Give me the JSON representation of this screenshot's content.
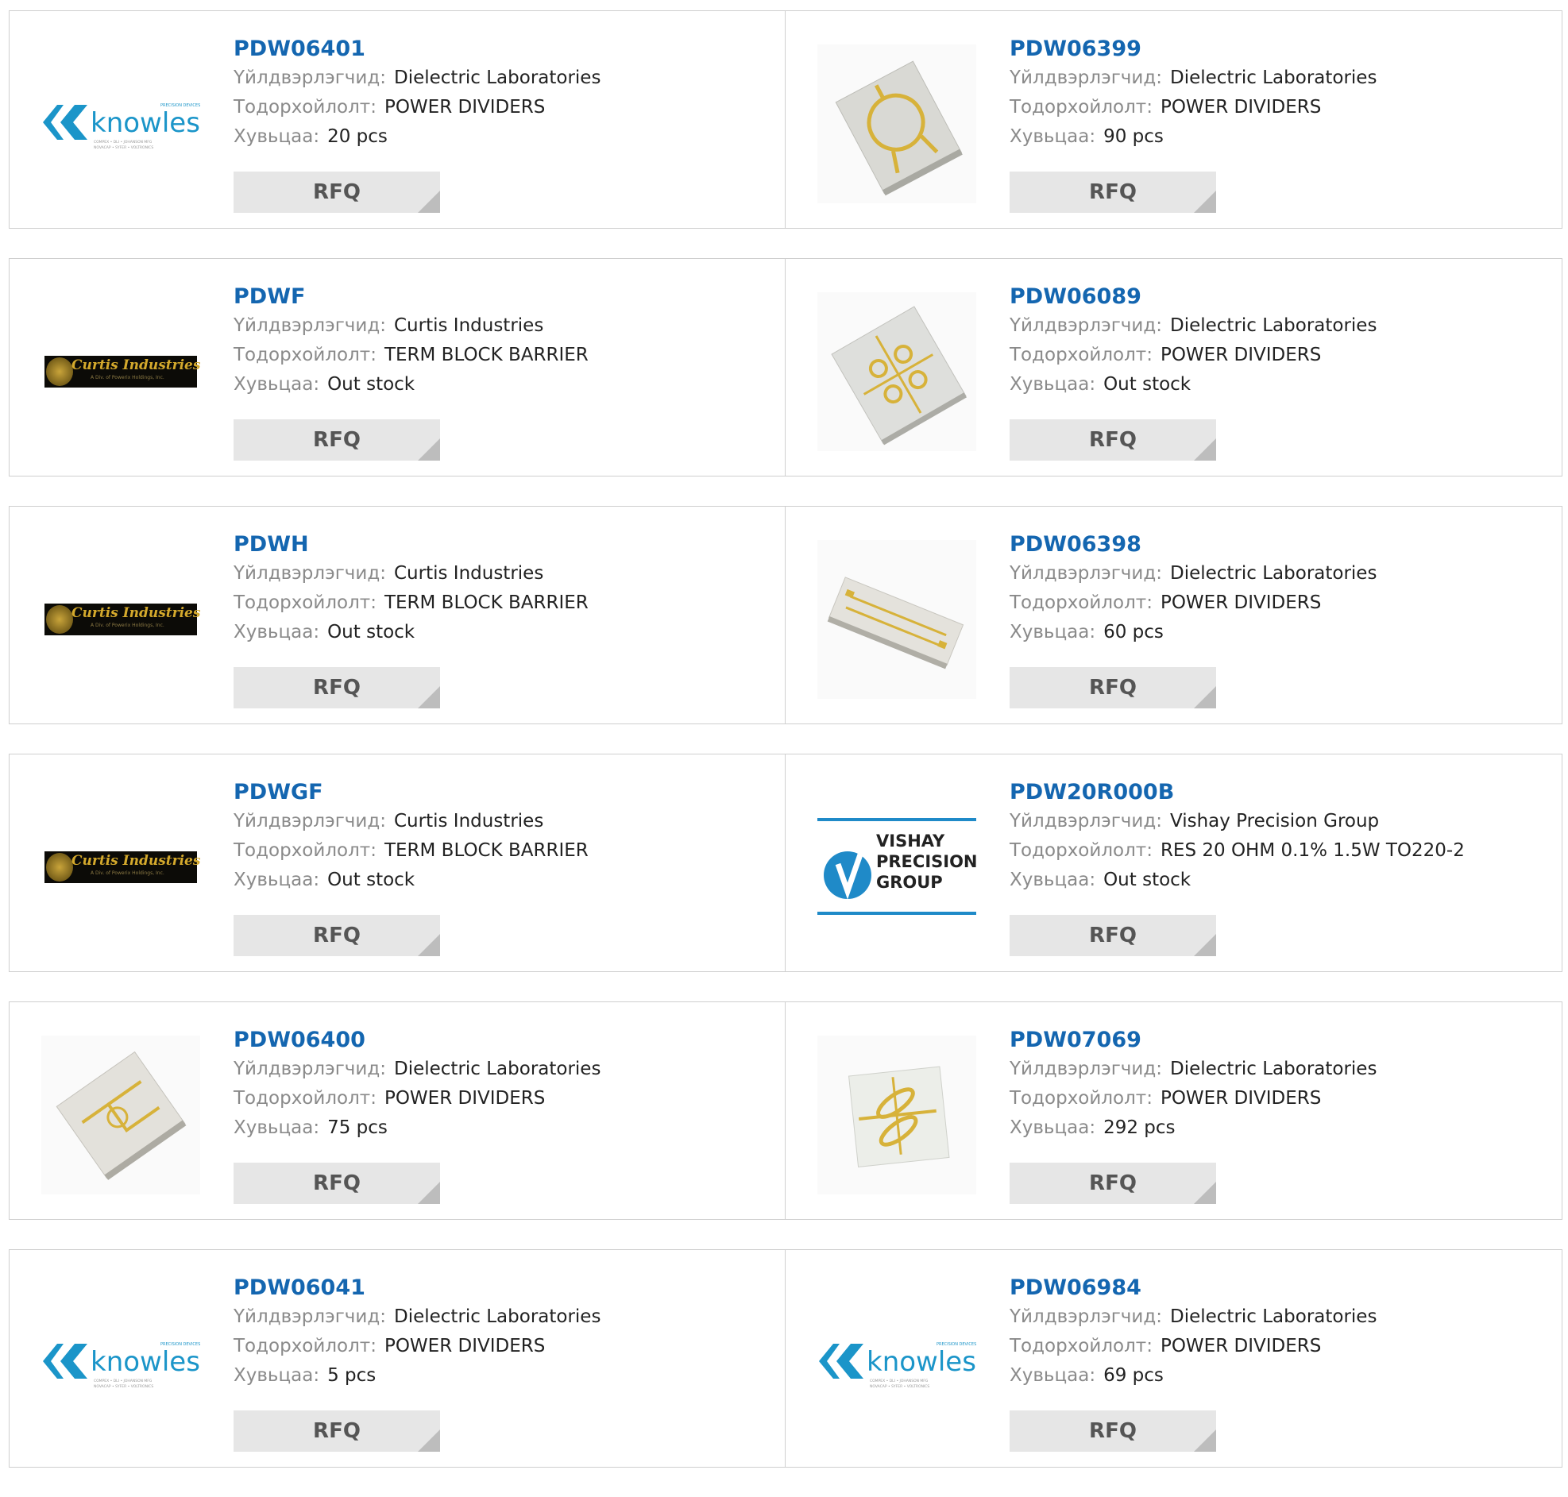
{
  "labels": {
    "manufacturer": "Үйлдвэрлэгчид:",
    "description": "Тодорхойлолт:",
    "stock": "Хувьцаа:",
    "rfq": "RFQ"
  },
  "products": [
    {
      "part": "PDW06401",
      "manufacturer": "Dielectric Laboratories",
      "description": "POWER DIVIDERS",
      "stock": "20 pcs",
      "image": "knowles-logo"
    },
    {
      "part": "PDW06399",
      "manufacturer": "Dielectric Laboratories",
      "description": "POWER DIVIDERS",
      "stock": "90 pcs",
      "image": "chip-circle"
    },
    {
      "part": "PDWF",
      "manufacturer": "Curtis Industries",
      "description": "TERM BLOCK BARRIER",
      "stock": "Out stock",
      "image": "curtis-logo"
    },
    {
      "part": "PDW06089",
      "manufacturer": "Dielectric Laboratories",
      "description": "POWER DIVIDERS",
      "stock": "Out stock",
      "image": "chip-pattern"
    },
    {
      "part": "PDWH",
      "manufacturer": "Curtis Industries",
      "description": "TERM BLOCK BARRIER",
      "stock": "Out stock",
      "image": "curtis-logo"
    },
    {
      "part": "PDW06398",
      "manufacturer": "Dielectric Laboratories",
      "description": "POWER DIVIDERS",
      "stock": "60 pcs",
      "image": "chip-long"
    },
    {
      "part": "PDWGF",
      "manufacturer": "Curtis Industries",
      "description": "TERM BLOCK BARRIER",
      "stock": "Out stock",
      "image": "curtis-logo"
    },
    {
      "part": "PDW20R000B",
      "manufacturer": "Vishay Precision Group",
      "description": "RES 20 OHM 0.1% 1.5W TO220-2",
      "stock": "Out stock",
      "image": "vishay-logo"
    },
    {
      "part": "PDW06400",
      "manufacturer": "Dielectric Laboratories",
      "description": "POWER DIVIDERS",
      "stock": "75 pcs",
      "image": "chip-square"
    },
    {
      "part": "PDW07069",
      "manufacturer": "Dielectric Laboratories",
      "description": "POWER DIVIDERS",
      "stock": "292 pcs",
      "image": "chip-cross"
    },
    {
      "part": "PDW06041",
      "manufacturer": "Dielectric Laboratories",
      "description": "POWER DIVIDERS",
      "stock": "5 pcs",
      "image": "knowles-logo"
    },
    {
      "part": "PDW06984",
      "manufacturer": "Dielectric Laboratories",
      "description": "POWER DIVIDERS",
      "stock": "69 pcs",
      "image": "knowles-logo"
    }
  ],
  "logos": {
    "knowles": {
      "name": "knowles",
      "tag": "PRECISION DEVICES",
      "sub1": "COMPEX • DLI • JOHANSON MFG",
      "sub2": "NOVACAP • SYFER • VOLTRONICS"
    },
    "curtis": {
      "name": "Curtis Industries",
      "sub": "A Div. of Powerix Holdings, Inc."
    },
    "vishay": {
      "line1": "VISHAY",
      "line2": "PRECISION",
      "line3": "GROUP"
    }
  },
  "colors": {
    "part_link": "#1466b0",
    "label": "#8a8a8a",
    "value": "#222222",
    "rfq_bg": "#e6e6e6",
    "border": "#cfcfcf",
    "knowles_blue": "#1b95c9",
    "vishay_blue": "#1f8ac8"
  }
}
